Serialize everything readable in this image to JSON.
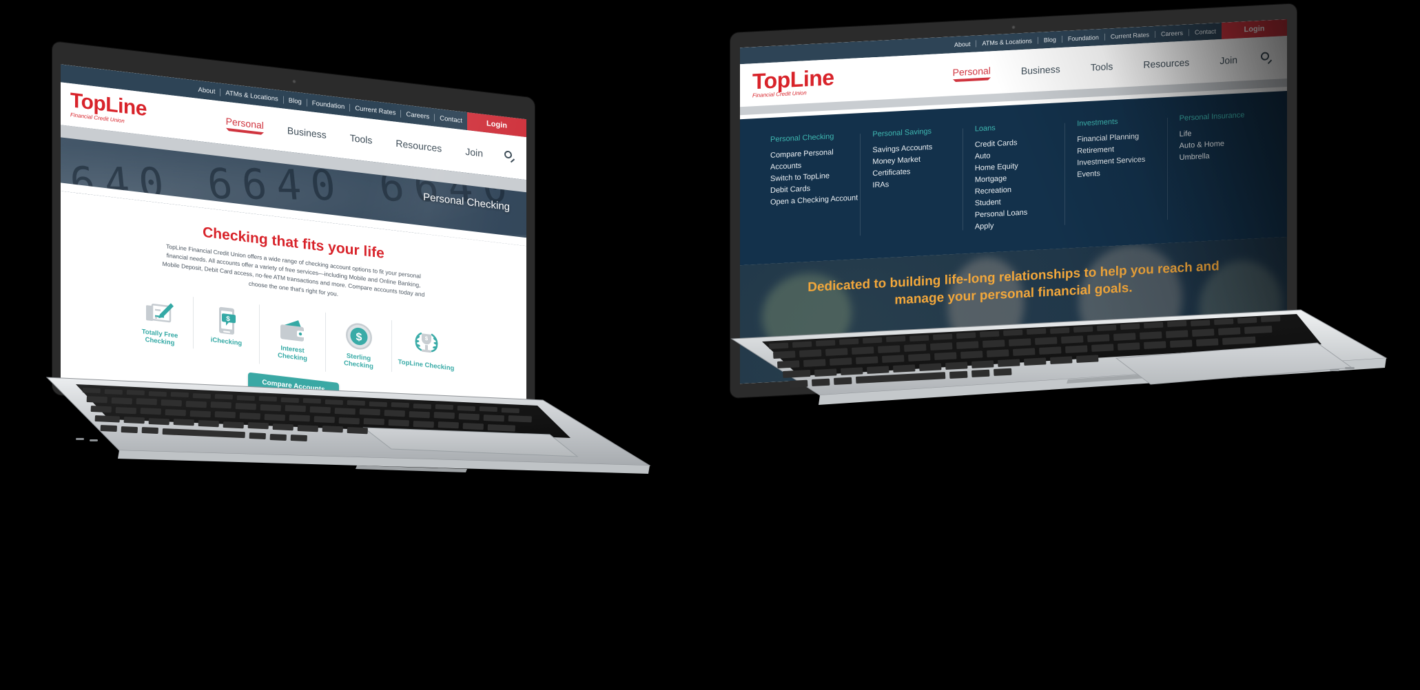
{
  "colors": {
    "brand_red": "#d8232a",
    "login_red": "#d0353f",
    "navy": "#13314b",
    "utility_navy": "#2e4456",
    "teal": "#3aa8a4",
    "menu_heading_teal": "#3fb9b2",
    "gold": "#f2a73b",
    "hero_slate": "#3d5062"
  },
  "logo": {
    "word": "TopLine",
    "tagline": "Financial Credit Union",
    "registered_mark": "®"
  },
  "utility_nav": {
    "items": [
      "About",
      "ATMs & Locations",
      "Blog",
      "Foundation",
      "Current Rates",
      "Careers",
      "Contact"
    ],
    "login_label": "Login"
  },
  "main_nav": {
    "items": [
      "Personal",
      "Business",
      "Tools",
      "Resources",
      "Join"
    ],
    "active": "Personal",
    "search_icon": "search-icon"
  },
  "left_laptop": {
    "hero": {
      "title": "Personal Checking",
      "background_digits": "6640"
    },
    "page": {
      "heading": "Checking that fits your life",
      "paragraph": "TopLine Financial Credit Union offers a wide range of checking account options to fit your personal financial needs. All accounts offer a variety of free services—including Mobile and Online Banking, Mobile Deposit, Debit Card access, no-fee ATM transactions and more. Compare accounts today and choose the one that's right for you.",
      "tiles": [
        {
          "label": "Totally Free Checking",
          "icon": "check-and-pen-icon"
        },
        {
          "label": "iChecking",
          "icon": "mobile-phone-dollar-icon"
        },
        {
          "label": "Interest Checking",
          "icon": "wallet-icon"
        },
        {
          "label": "Sterling Checking",
          "icon": "dollar-badge-icon"
        },
        {
          "label": "TopLine Checking",
          "icon": "trophy-laurel-icon"
        }
      ],
      "cta_label": "Compare Accounts"
    }
  },
  "right_laptop": {
    "mega_menu": {
      "columns": [
        {
          "heading": "Personal Checking",
          "links": [
            "Compare Personal Accounts",
            "Switch to TopLine",
            "Debit Cards",
            "Open a Checking Account"
          ]
        },
        {
          "heading": "Personal Savings",
          "links": [
            "Savings Accounts",
            "Money Market",
            "Certificates",
            "IRAs"
          ]
        },
        {
          "heading": "Loans",
          "links": [
            "Credit Cards",
            "Auto",
            "Home Equity",
            "Mortgage",
            "Recreation",
            "Student",
            "Personal Loans",
            "Apply"
          ]
        },
        {
          "heading": "Investments",
          "links": [
            "Financial Planning",
            "Retirement",
            "Investment Services Events"
          ]
        },
        {
          "heading": "Personal Insurance",
          "links": [
            "Life",
            "Auto & Home",
            "Umbrella"
          ]
        }
      ]
    },
    "hero_tagline": "Dedicated to building life-long relationships to help you reach and manage your personal financial goals."
  }
}
